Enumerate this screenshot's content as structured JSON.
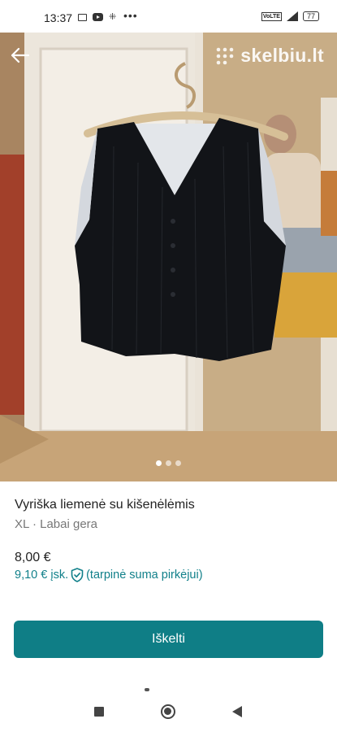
{
  "status_bar": {
    "time": "13:37",
    "battery": "77",
    "network": "VoLTE",
    "icons": [
      "messages-icon",
      "youtube-icon",
      "grid-icon",
      "more-dots-icon",
      "volte-icon",
      "signal-icon",
      "battery-icon"
    ]
  },
  "header": {
    "back_icon": "arrow-left-icon",
    "watermark": "skelbiu.lt"
  },
  "gallery": {
    "photo_subject": "dark pinstriped vest on a hanger",
    "page_count": 3,
    "active_page": 1
  },
  "listing": {
    "title": "Vyriška liemenė su kišenėlėmis",
    "subtitle": "XL · Labai gera",
    "price": "8,00 €",
    "price_including_prefix": "9,10 € įsk.",
    "price_including_suffix": "(tarpinė suma pirkėjui)"
  },
  "actions": {
    "primary_label": "Iškelti"
  },
  "colors": {
    "accent": "#0f7e86",
    "accent_text": "#11808a",
    "title": "#222222",
    "muted": "#777777"
  },
  "nav_bar": {
    "icons": [
      "recent-apps-icon",
      "home-icon",
      "back-triangle-icon"
    ]
  }
}
